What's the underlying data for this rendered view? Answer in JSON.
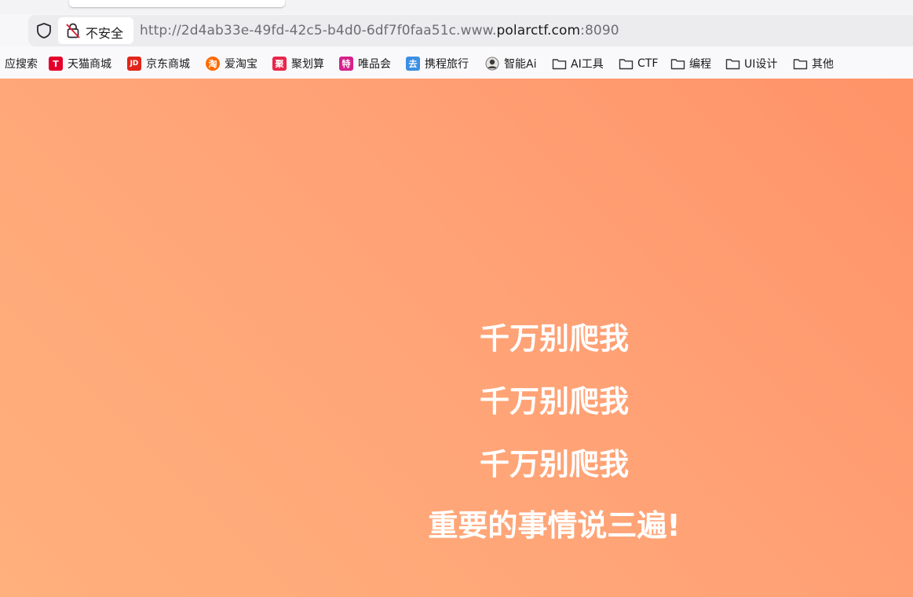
{
  "browser": {
    "security_label": "不安全",
    "url_prefix": "http://2d4ab33e-49fd-42c5-b4d0-6df7f0faa51c.www.",
    "url_host": "polarctf.com",
    "url_port": ":8090"
  },
  "bookmarks": [
    {
      "label": "应搜索",
      "icon": "search-app-icon",
      "color": "#ffffff"
    },
    {
      "label": "天猫商城",
      "icon": "tmall-icon",
      "glyph": "T",
      "color": "#e4002b"
    },
    {
      "label": "京东商城",
      "icon": "jd-icon",
      "glyph": "JD",
      "color": "#e1251b"
    },
    {
      "label": "爱淘宝",
      "icon": "taobao-icon",
      "glyph": "淘",
      "color": "#ff6a00"
    },
    {
      "label": "聚划算",
      "icon": "juhuasuan-icon",
      "glyph": "聚",
      "color": "#e8264a"
    },
    {
      "label": "唯品会",
      "icon": "vip-icon",
      "glyph": "特",
      "color": "#d5218b"
    },
    {
      "label": "携程旅行",
      "icon": "ctrip-icon",
      "glyph": "去",
      "color": "#3c8fe3"
    },
    {
      "label": "智能Ai",
      "icon": "avatar-icon",
      "color": "#555555"
    },
    {
      "label": "AI工具",
      "icon": "folder-icon"
    },
    {
      "label": "CTF",
      "icon": "folder-icon"
    },
    {
      "label": "编程",
      "icon": "folder-icon"
    },
    {
      "label": "UI设计",
      "icon": "folder-icon"
    },
    {
      "label": "其他",
      "icon": "folder-icon"
    }
  ],
  "page": {
    "lines": [
      "千万别爬我",
      "千万别爬我",
      "千万别爬我",
      "重要的事情说三遍!"
    ]
  }
}
